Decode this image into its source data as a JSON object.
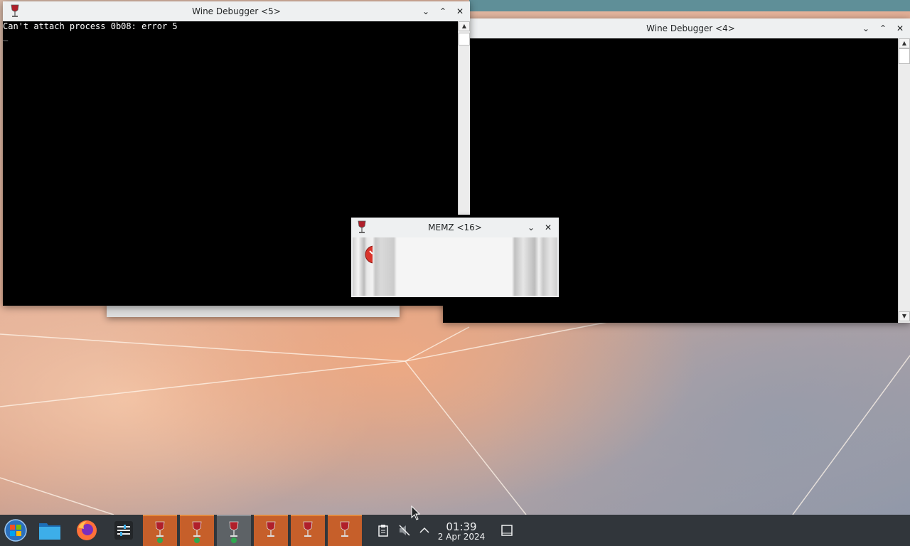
{
  "windows": {
    "debugger5": {
      "title": "Wine Debugger <5>",
      "console_line": "Can't attach process 0b08: error 5",
      "cursor_char": "_"
    },
    "debugger4": {
      "title": "Wine Debugger <4>"
    },
    "memz": {
      "title": "MEMZ <16>"
    }
  },
  "titlebar_buttons": {
    "minimize": "⌄",
    "maximize": "⌃",
    "close": "✕"
  },
  "scrollbar": {
    "up": "▲",
    "down": "▼"
  },
  "taskbar": {
    "start_icon": "kde-start-menu-icon",
    "pinned": [
      "file-manager-icon",
      "firefox-icon",
      "system-settings-icon"
    ],
    "wine_tasks": [
      {
        "icon": "wine-glass-icon",
        "shield": true,
        "active": false
      },
      {
        "icon": "wine-glass-icon",
        "shield": true,
        "active": false
      },
      {
        "icon": "wine-glass-icon",
        "shield": true,
        "active": true
      },
      {
        "icon": "wine-glass-icon",
        "shield": false,
        "active": false
      },
      {
        "icon": "wine-glass-icon",
        "shield": false,
        "active": false
      },
      {
        "icon": "wine-glass-icon",
        "shield": false,
        "active": false
      }
    ],
    "tray": {
      "clipboard_icon": "clipboard-icon",
      "volume_icon": "volume-muted-icon",
      "expand_icon": "chevron-up-icon",
      "show_desktop_icon": "show-desktop-icon"
    },
    "clock": {
      "time": "01:39",
      "date": "2 Apr 2024"
    }
  },
  "colors": {
    "taskbar_bg": "#31363b",
    "task_highlight": "#c65f2a",
    "titlebar_bg": "#eef0f1",
    "console_bg": "#000000"
  }
}
